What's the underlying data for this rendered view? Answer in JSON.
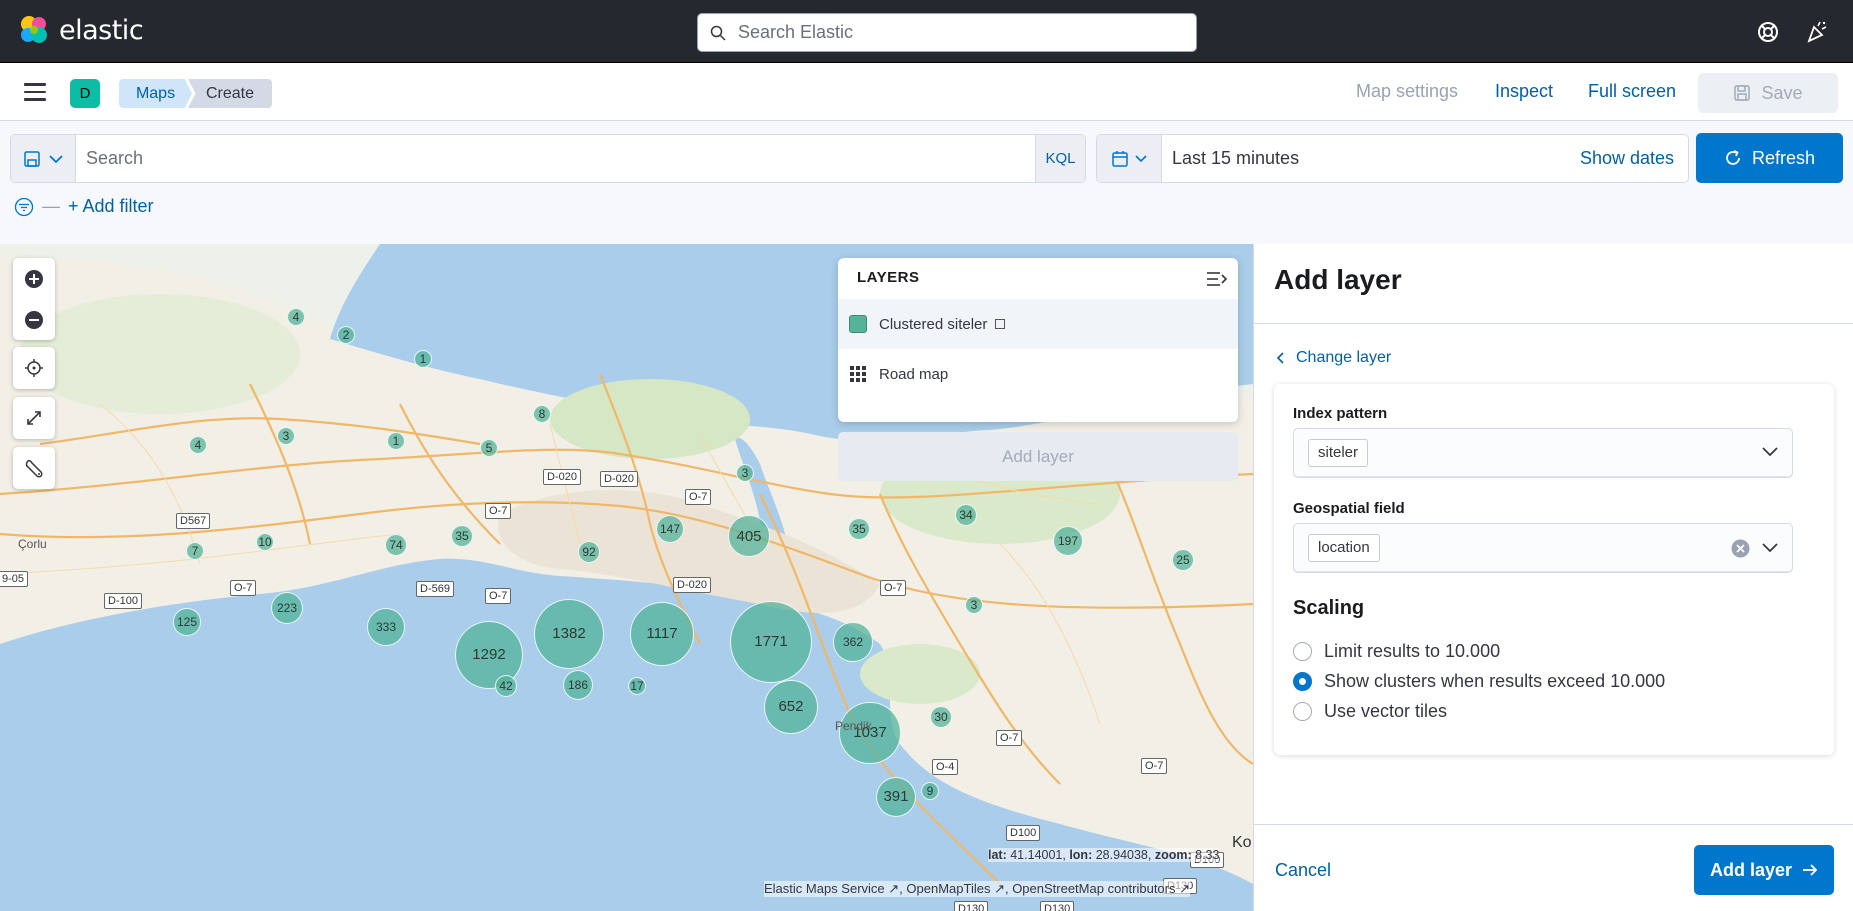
{
  "header": {
    "logo_text": "elastic",
    "search_placeholder": "Search Elastic",
    "help_icon": "help-icon",
    "news_icon": "newsfeed-icon"
  },
  "nav": {
    "space": "D",
    "breadcrumbs": [
      "Maps",
      "Create"
    ],
    "links": [
      "Map settings",
      "Inspect",
      "Full screen"
    ],
    "save_label": "Save"
  },
  "query": {
    "search_placeholder": "Search",
    "kql_label": "KQL",
    "time_range": "Last 15 minutes",
    "show_dates": "Show dates",
    "refresh_label": "Refresh",
    "add_filter": "+ Add filter"
  },
  "map": {
    "layers_title": "LAYERS",
    "layers": [
      {
        "name": "Clustered siteler",
        "swatch": "#54b399"
      },
      {
        "name": "Road map",
        "icon": "grid-icon"
      }
    ],
    "add_layer_label": "Add layer",
    "coords": {
      "lat": "41.14001",
      "lon": "28.94038",
      "zoom": "8.33"
    },
    "attribution": [
      "Elastic Maps Service",
      "OpenMapTiles",
      "OpenStreetMap contributors"
    ],
    "clusters": [
      "4",
      "2",
      "1",
      "8",
      "4",
      "3",
      "1",
      "5",
      "3",
      "10",
      "7",
      "74",
      "35",
      "92",
      "147",
      "405",
      "35",
      "34",
      "197",
      "25",
      "3",
      "223",
      "125",
      "333",
      "1292",
      "42",
      "1382",
      "186",
      "17",
      "1117",
      "1771",
      "362",
      "652",
      "1037",
      "30",
      "9",
      "391"
    ],
    "places": [
      "Çorlu",
      "Pendik",
      "Ko"
    ],
    "road_labels": [
      "D-020",
      "D-020",
      "D-020",
      "O-7",
      "O-7",
      "O-7",
      "O-7",
      "O-7",
      "O-7",
      "O-7",
      "D567",
      "D-569",
      "D-100",
      "O-4",
      "D100",
      "D100",
      "D130",
      "D130",
      "D130",
      "9-05"
    ]
  },
  "panel": {
    "title": "Add layer",
    "change_layer": "Change layer",
    "index_pattern_label": "Index pattern",
    "index_pattern_value": "siteler",
    "geo_field_label": "Geospatial field",
    "geo_field_value": "location",
    "scaling_title": "Scaling",
    "scaling_options": [
      "Limit results to 10.000",
      "Show clusters when results exceed 10.000",
      "Use vector tiles"
    ],
    "scaling_selected": "Show clusters when results exceed 10.000",
    "cancel_label": "Cancel",
    "add_layer_label": "Add layer"
  },
  "colors": {
    "accent": "#0077cc",
    "cluster": "#54b399",
    "topbar": "#25282f"
  }
}
